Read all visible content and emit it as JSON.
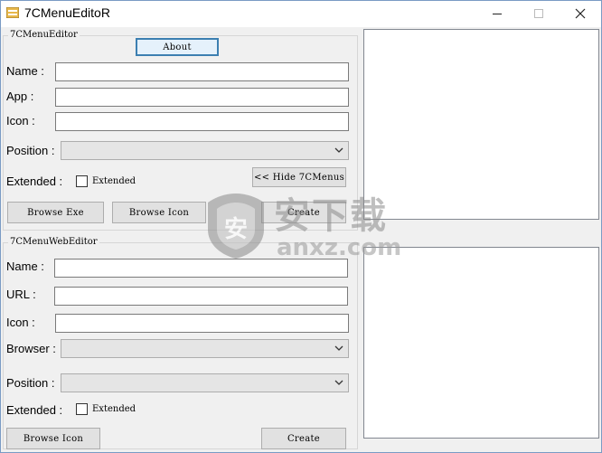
{
  "window": {
    "title": "7CMenuEditoR",
    "controls": [
      "minimize-icon",
      "maximize-icon",
      "close-icon"
    ]
  },
  "menu_editor": {
    "group_title": "7CMenuEditor",
    "about_label": "About",
    "name_label": "Name :",
    "name_value": "",
    "app_label": "App :",
    "app_value": "",
    "icon_label": "Icon :",
    "icon_value": "",
    "position_label": "Position :",
    "position_value": "",
    "extended_label": "Extended :",
    "extended_checkbox_label": "Extended",
    "extended_checked": false,
    "hide_menus_label": "<< Hide 7CMenus",
    "browse_exe_label": "Browse Exe",
    "browse_icon_label": "Browse Icon",
    "create_label": "Create"
  },
  "web_editor": {
    "group_title": "7CMenuWebEditor",
    "name_label": "Name :",
    "name_value": "",
    "url_label": "URL :",
    "url_value": "",
    "icon_label": "Icon :",
    "icon_value": "",
    "browser_label": "Browser :",
    "browser_value": "",
    "position_label": "Position :",
    "position_value": "",
    "extended_label": "Extended :",
    "extended_checkbox_label": "Extended",
    "extended_checked": false,
    "browse_icon_label": "Browse Icon",
    "create_label": "Create"
  },
  "watermark": {
    "text_cn": "安下载",
    "text_en": "anxz.com"
  }
}
